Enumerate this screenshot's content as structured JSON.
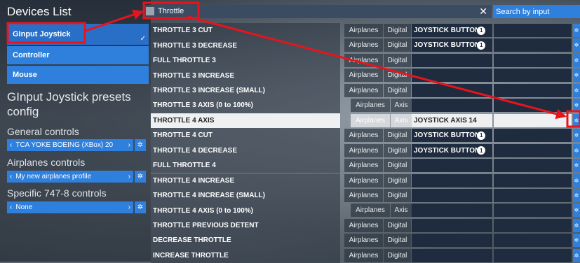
{
  "left": {
    "devices_title": "Devices List",
    "devices": [
      {
        "label": "GInput Joystick",
        "selected": true
      },
      {
        "label": "Controller",
        "selected": false
      },
      {
        "label": "Mouse",
        "selected": false
      }
    ],
    "presets_title": "GInput Joystick presets config",
    "sections": [
      {
        "title": "General controls",
        "value": "TCA YOKE BOEING (XBox) 20"
      },
      {
        "title": "Airplanes controls",
        "value": "My new airplanes profile"
      },
      {
        "title": "Specific 747-8 controls",
        "value": "None"
      }
    ]
  },
  "search": {
    "value": "Throttle",
    "clear_glyph": "✕",
    "search_by_input_label": "Search by input"
  },
  "table": {
    "rows": [
      {
        "name": "THROTTLE 3 CUT",
        "c1": "Airplanes",
        "c2": "Digital",
        "binding": "JOYSTICK BUTTON",
        "badge": "1"
      },
      {
        "name": "THROTTLE 3 DECREASE",
        "c1": "Airplanes",
        "c2": "Digital",
        "binding": "JOYSTICK BUTTON",
        "badge": "1"
      },
      {
        "name": "FULL THROTTLE 3",
        "c1": "Airplanes",
        "c2": "Digital",
        "binding": "",
        "badge": ""
      },
      {
        "name": "THROTTLE 3 INCREASE",
        "c1": "Airplanes",
        "c2": "Digital",
        "binding": "",
        "badge": ""
      },
      {
        "name": "THROTTLE 3 INCREASE (SMALL)",
        "c1": "Airplanes",
        "c2": "Digital",
        "binding": "",
        "badge": ""
      },
      {
        "name": "THROTTLE 3 AXIS (0 to 100%)",
        "c1": "Airplanes",
        "c2": "Axis",
        "binding": "",
        "badge": ""
      },
      {
        "name": "THROTTLE 4 AXIS",
        "c1": "Airplanes",
        "c2": "Axis",
        "binding": "JOYSTICK AXIS 14",
        "badge": "",
        "highlighted": true
      },
      {
        "name": "THROTTLE 4 CUT",
        "c1": "Airplanes",
        "c2": "Digital",
        "binding": "JOYSTICK BUTTON",
        "badge": "1"
      },
      {
        "name": "THROTTLE 4 DECREASE",
        "c1": "Airplanes",
        "c2": "Digital",
        "binding": "JOYSTICK BUTTON",
        "badge": "1"
      },
      {
        "name": "FULL THROTTLE 4",
        "c1": "Airplanes",
        "c2": "Digital",
        "binding": "",
        "badge": ""
      },
      {
        "name": "THROTTLE 4 INCREASE",
        "c1": "Airplanes",
        "c2": "Digital",
        "binding": "",
        "badge": ""
      },
      {
        "name": "THROTTLE 4 INCREASE (SMALL)",
        "c1": "Airplanes",
        "c2": "Digital",
        "binding": "",
        "badge": ""
      },
      {
        "name": "THROTTLE 4 AXIS (0 to 100%)",
        "c1": "Airplanes",
        "c2": "Axis",
        "binding": "",
        "badge": ""
      },
      {
        "name": "THROTTLE PREVIOUS DETENT",
        "c1": "Airplanes",
        "c2": "Digital",
        "binding": "",
        "badge": ""
      },
      {
        "name": "DECREASE THROTTLE",
        "c1": "Airplanes",
        "c2": "Digital",
        "binding": "",
        "badge": ""
      },
      {
        "name": "INCREASE THROTTLE",
        "c1": "Airplanes",
        "c2": "Digital",
        "binding": "",
        "badge": ""
      }
    ]
  },
  "icons": {
    "gear": "gear-icon",
    "chevron_left": "chevron-left-icon",
    "chevron_right": "chevron-right-icon",
    "check": "check-icon"
  },
  "colors": {
    "accent_blue": "#2f7fdc",
    "annotation_red": "#e8141b",
    "binding_slot": "#1f2c3f"
  }
}
